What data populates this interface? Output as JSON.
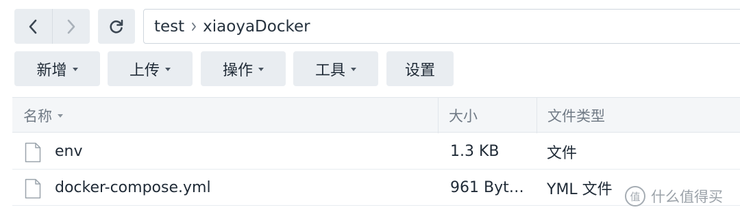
{
  "navigation": {
    "back_icon": "chevron-left-icon",
    "forward_icon": "chevron-right-icon",
    "refresh_icon": "refresh-icon"
  },
  "path": {
    "segments": [
      "test",
      "xiaoyaDocker"
    ]
  },
  "toolbar": {
    "create_label": "新增",
    "upload_label": "上传",
    "action_label": "操作",
    "tools_label": "工具",
    "settings_label": "设置"
  },
  "table": {
    "columns": {
      "name": "名称",
      "size": "大小",
      "type": "文件类型"
    },
    "rows": [
      {
        "name": "env",
        "size": "1.3 KB",
        "type": "文件"
      },
      {
        "name": "docker-compose.yml",
        "size": "961 Byt…",
        "type": "YML 文件"
      }
    ]
  },
  "watermark": {
    "badge": "值",
    "text": "什么值得买"
  },
  "colors": {
    "button_bg": "#e9edf1",
    "header_bg": "#f4f6f8",
    "text": "#1f2a36",
    "muted_text": "#707a85"
  }
}
